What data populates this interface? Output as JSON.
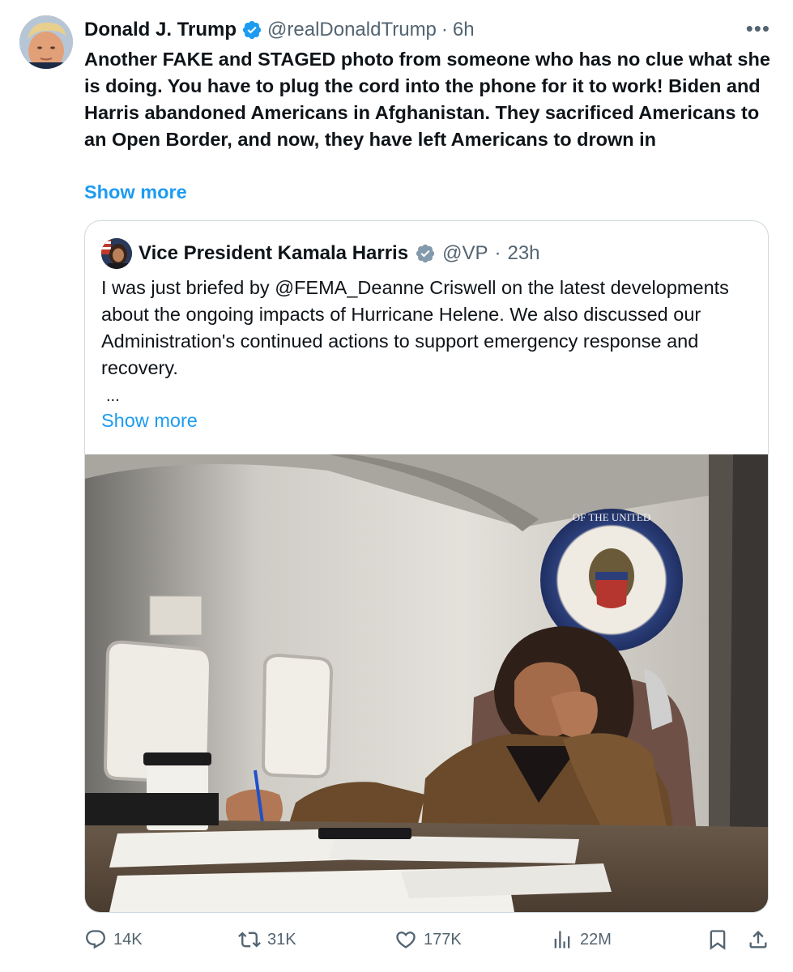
{
  "tweet": {
    "author_name": "Donald J. Trump",
    "handle": "@realDonaldTrump",
    "separator": "·",
    "time": "6h",
    "more_label": "•••",
    "text": "Another FAKE and STAGED photo from someone who has no clue what she is doing. You have to plug the cord into the phone for it to work! Biden and Harris abandoned Americans in Afghanistan. They sacrificed Americans to an Open Border, and now, they have left Americans to drown in",
    "show_more": "Show more"
  },
  "quote": {
    "author_name": "Vice President Kamala Harris",
    "handle": "@VP",
    "separator": "·",
    "time": "23h",
    "text": "I was just briefed by @FEMA_Deanne Criswell on the latest developments about the ongoing impacts of Hurricane Helene. We also discussed our Administration's continued actions to support emergency response and recovery.",
    "ellipsis": "...",
    "show_more": "Show more",
    "seal_text": "VICE PRESIDENT OF THE UNITED STATES"
  },
  "actions": {
    "replies": "14K",
    "reposts": "31K",
    "likes": "177K",
    "views": "22M"
  },
  "colors": {
    "accent": "#1d9bf0",
    "secondary_text": "#536471",
    "verified_gray": "#829aab",
    "border": "#cfd9de"
  },
  "icons": [
    "verified-badge-icon",
    "more-icon",
    "reply-icon",
    "repost-icon",
    "like-icon",
    "views-icon",
    "bookmark-icon",
    "share-icon"
  ]
}
